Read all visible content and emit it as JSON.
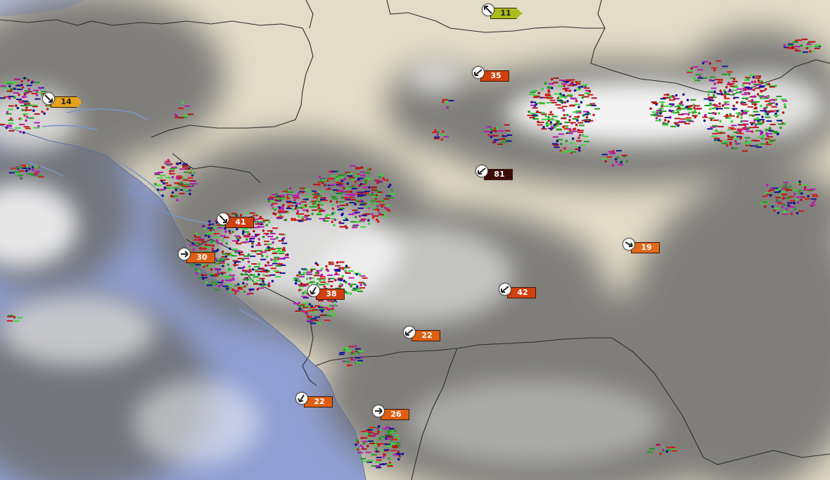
{
  "map": {
    "type": "weather-radar-lightning",
    "colors": {
      "land": "#e3dcc7",
      "ocean": "#8f9fd3",
      "cloud_shadow": "#6e6e6e",
      "cloud_bright": "#fbfbfb",
      "border": "#2c2c2c",
      "river": "#7c95c6"
    },
    "lightning_palette": [
      "#b01616",
      "#d01e1e",
      "#1f9a1f",
      "#3ed23e",
      "#14149a",
      "#b41cb4"
    ]
  },
  "wind_markers": [
    {
      "id": "m11",
      "label": "11",
      "color": "#a9be1c",
      "shape": "pointed",
      "text_dark": true,
      "icon": "wind-arrow-icon"
    },
    {
      "id": "m14",
      "label": "14",
      "color": "#e2a31b",
      "shape": "pointed",
      "text_dark": true,
      "icon": "wind-arrow-icon"
    },
    {
      "id": "m35",
      "label": "35",
      "color": "#d2400f",
      "shape": "box",
      "text_dark": false,
      "icon": "wind-arrow-icon"
    },
    {
      "id": "m81",
      "label": "81",
      "color": "#3d0c06",
      "shape": "box",
      "text_dark": false,
      "icon": "wind-arrow-icon"
    },
    {
      "id": "m41",
      "label": "41",
      "color": "#d2400f",
      "shape": "box",
      "text_dark": false,
      "icon": "wind-arrow-icon"
    },
    {
      "id": "m30",
      "label": "30",
      "color": "#de5f12",
      "shape": "box",
      "text_dark": false,
      "icon": "wind-arrow-icon"
    },
    {
      "id": "m19",
      "label": "19",
      "color": "#e2681a",
      "shape": "box",
      "text_dark": false,
      "icon": "wind-arrow-icon"
    },
    {
      "id": "m38",
      "label": "38",
      "color": "#d2400f",
      "shape": "box",
      "text_dark": false,
      "icon": "wind-arrow-icon"
    },
    {
      "id": "m42",
      "label": "42",
      "color": "#d2400f",
      "shape": "box",
      "text_dark": false,
      "icon": "wind-arrow-icon"
    },
    {
      "id": "m22a",
      "label": "22",
      "color": "#de5f12",
      "shape": "box",
      "text_dark": false,
      "icon": "wind-arrow-icon"
    },
    {
      "id": "m22b",
      "label": "22",
      "color": "#de5f12",
      "shape": "box",
      "text_dark": false,
      "icon": "wind-arrow-icon"
    },
    {
      "id": "m26",
      "label": "26",
      "color": "#de5f12",
      "shape": "box",
      "text_dark": false,
      "icon": "wind-arrow-icon"
    }
  ]
}
